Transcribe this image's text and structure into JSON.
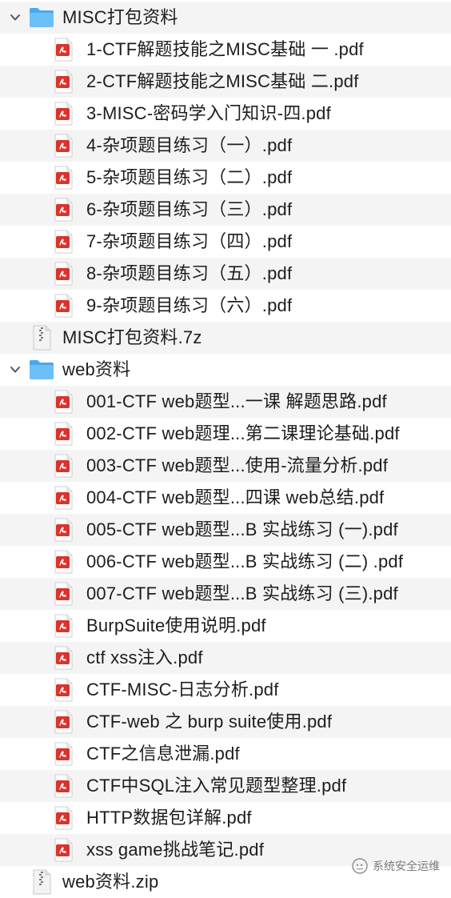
{
  "tree": [
    {
      "type": "folder",
      "level": 0,
      "expanded": true,
      "label": "MISC打包资料"
    },
    {
      "type": "pdf",
      "level": 1,
      "label": "1-CTF解题技能之MISC基础 一 .pdf"
    },
    {
      "type": "pdf",
      "level": 1,
      "label": "2-CTF解题技能之MISC基础 二.pdf"
    },
    {
      "type": "pdf",
      "level": 1,
      "label": "3-MISC-密码学入门知识-四.pdf"
    },
    {
      "type": "pdf",
      "level": 1,
      "label": "4-杂项题目练习（一）.pdf"
    },
    {
      "type": "pdf",
      "level": 1,
      "label": "5-杂项题目练习（二）.pdf"
    },
    {
      "type": "pdf",
      "level": 1,
      "label": "6-杂项题目练习（三）.pdf"
    },
    {
      "type": "pdf",
      "level": 1,
      "label": "7-杂项题目练习（四）.pdf"
    },
    {
      "type": "pdf",
      "level": 1,
      "label": "8-杂项题目练习（五）.pdf"
    },
    {
      "type": "pdf",
      "level": 1,
      "label": "9-杂项题目练习（六）.pdf"
    },
    {
      "type": "archive",
      "level": 0,
      "label": "MISC打包资料.7z"
    },
    {
      "type": "folder",
      "level": 0,
      "expanded": true,
      "label": "web资料"
    },
    {
      "type": "pdf",
      "level": 1,
      "label": "001-CTF web题型...一课 解题思路.pdf"
    },
    {
      "type": "pdf",
      "level": 1,
      "label": "002-CTF web题理...第二课理论基础.pdf"
    },
    {
      "type": "pdf",
      "level": 1,
      "label": "003-CTF web题型...使用-流量分析.pdf"
    },
    {
      "type": "pdf",
      "level": 1,
      "label": "004-CTF web题型...四课 web总结.pdf"
    },
    {
      "type": "pdf",
      "level": 1,
      "label": "005-CTF web题型...B 实战练习 (一).pdf"
    },
    {
      "type": "pdf",
      "level": 1,
      "label": "006-CTF web题型...B 实战练习 (二) .pdf"
    },
    {
      "type": "pdf",
      "level": 1,
      "label": "007-CTF web题型...B 实战练习 (三).pdf"
    },
    {
      "type": "pdf",
      "level": 1,
      "label": "BurpSuite使用说明.pdf"
    },
    {
      "type": "pdf",
      "level": 1,
      "label": "ctf xss注入.pdf"
    },
    {
      "type": "pdf",
      "level": 1,
      "label": "CTF-MISC-日志分析.pdf"
    },
    {
      "type": "pdf",
      "level": 1,
      "label": "CTF-web 之 burp suite使用.pdf"
    },
    {
      "type": "pdf",
      "level": 1,
      "label": "CTF之信息泄漏.pdf"
    },
    {
      "type": "pdf",
      "level": 1,
      "label": "CTF中SQL注入常见题型整理.pdf"
    },
    {
      "type": "pdf",
      "level": 1,
      "label": "HTTP数据包详解.pdf"
    },
    {
      "type": "pdf",
      "level": 1,
      "label": "xss game挑战笔记.pdf"
    },
    {
      "type": "archive",
      "level": 0,
      "label": "web资料.zip"
    }
  ],
  "watermark": {
    "text": "系统安全运维",
    "icon": "wechat-icon"
  },
  "colors": {
    "stripe": "#f4f4f5",
    "folder": "#5fb8f5",
    "pdf_red": "#d9342b"
  }
}
